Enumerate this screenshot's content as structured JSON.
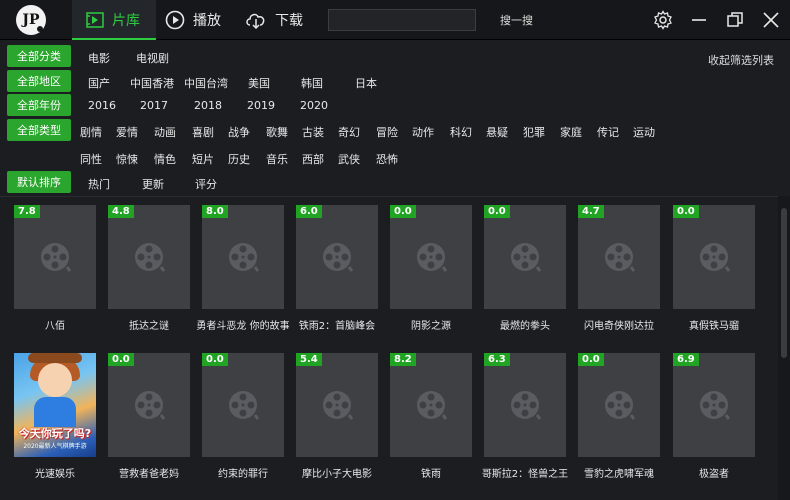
{
  "app": {
    "logo_text": "JP"
  },
  "nav": {
    "library_label": "片库",
    "play_label": "播放",
    "download_label": "下载"
  },
  "search": {
    "value": "",
    "placeholder": "",
    "button_label": "搜一搜"
  },
  "filters": {
    "collapse_label": "收起筛选列表",
    "category": {
      "label": "全部分类",
      "options": [
        "电影",
        "电视剧"
      ]
    },
    "region": {
      "label": "全部地区",
      "options": [
        "国产",
        "中国香港",
        "中国台湾",
        "美国",
        "韩国",
        "日本"
      ]
    },
    "year": {
      "label": "全部年份",
      "options": [
        "2016",
        "2017",
        "2018",
        "2019",
        "2020"
      ]
    },
    "genre": {
      "label": "全部类型",
      "options_row1": [
        "剧情",
        "爱情",
        "动画",
        "喜剧",
        "战争",
        "歌舞",
        "古装",
        "奇幻",
        "冒险",
        "动作",
        "科幻",
        "悬疑",
        "犯罪",
        "家庭",
        "传记",
        "运动"
      ],
      "options_row2": [
        "同性",
        "惊悚",
        "情色",
        "短片",
        "历史",
        "音乐",
        "西部",
        "武侠",
        "恐怖"
      ]
    },
    "sort": {
      "label": "默认排序",
      "options": [
        "热门",
        "更新",
        "评分"
      ]
    }
  },
  "movies_row1": [
    {
      "score": "7.8",
      "title": "八佰"
    },
    {
      "score": "4.8",
      "title": "抵达之谜"
    },
    {
      "score": "8.0",
      "title": "勇者斗恶龙 你的故事"
    },
    {
      "score": "6.0",
      "title": "铁雨2：首脑峰会"
    },
    {
      "score": "0.0",
      "title": "阴影之源"
    },
    {
      "score": "0.0",
      "title": "最燃的拳头"
    },
    {
      "score": "4.7",
      "title": "闪电奇侠刚达拉"
    },
    {
      "score": "0.0",
      "title": "真假铁马骝"
    }
  ],
  "movies_row2": [
    {
      "score": "",
      "title": "光速娱乐",
      "ad_text": "今天你玩了吗?",
      "ad_sub": "2020最新人气棋牌手游"
    },
    {
      "score": "0.0",
      "title": "营救者爸老妈"
    },
    {
      "score": "0.0",
      "title": "约束的罪行"
    },
    {
      "score": "5.4",
      "title": "摩比小子大电影"
    },
    {
      "score": "8.2",
      "title": "铁雨"
    },
    {
      "score": "6.3",
      "title": "哥斯拉2：怪兽之王"
    },
    {
      "score": "0.0",
      "title": "雪豹之虎啸军魂"
    },
    {
      "score": "6.9",
      "title": "极盗者"
    }
  ]
}
